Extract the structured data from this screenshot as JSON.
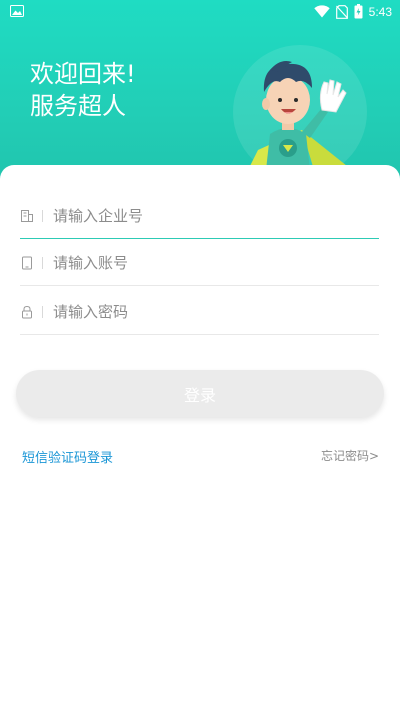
{
  "status_bar": {
    "time": "5:43",
    "icons": [
      "image-icon",
      "wifi-icon",
      "no-sim-icon",
      "battery-charging-icon"
    ]
  },
  "header": {
    "line1": "欢迎回来!",
    "line2": "服务超人",
    "mascot": "superhero-mascot-waving"
  },
  "form": {
    "company_placeholder": "请输入企业号",
    "account_placeholder": "请输入账号",
    "password_placeholder": "请输入密码",
    "company_icon": "building-icon",
    "account_icon": "phone-icon",
    "password_icon": "lock-icon"
  },
  "actions": {
    "login_label": "登录",
    "sms_login_label": "短信验证码登录",
    "forgot_label": "忘记密码>"
  },
  "colors": {
    "brand": "#22cdb5",
    "link": "#1a96d6",
    "button_disabled": "#ebebeb"
  }
}
